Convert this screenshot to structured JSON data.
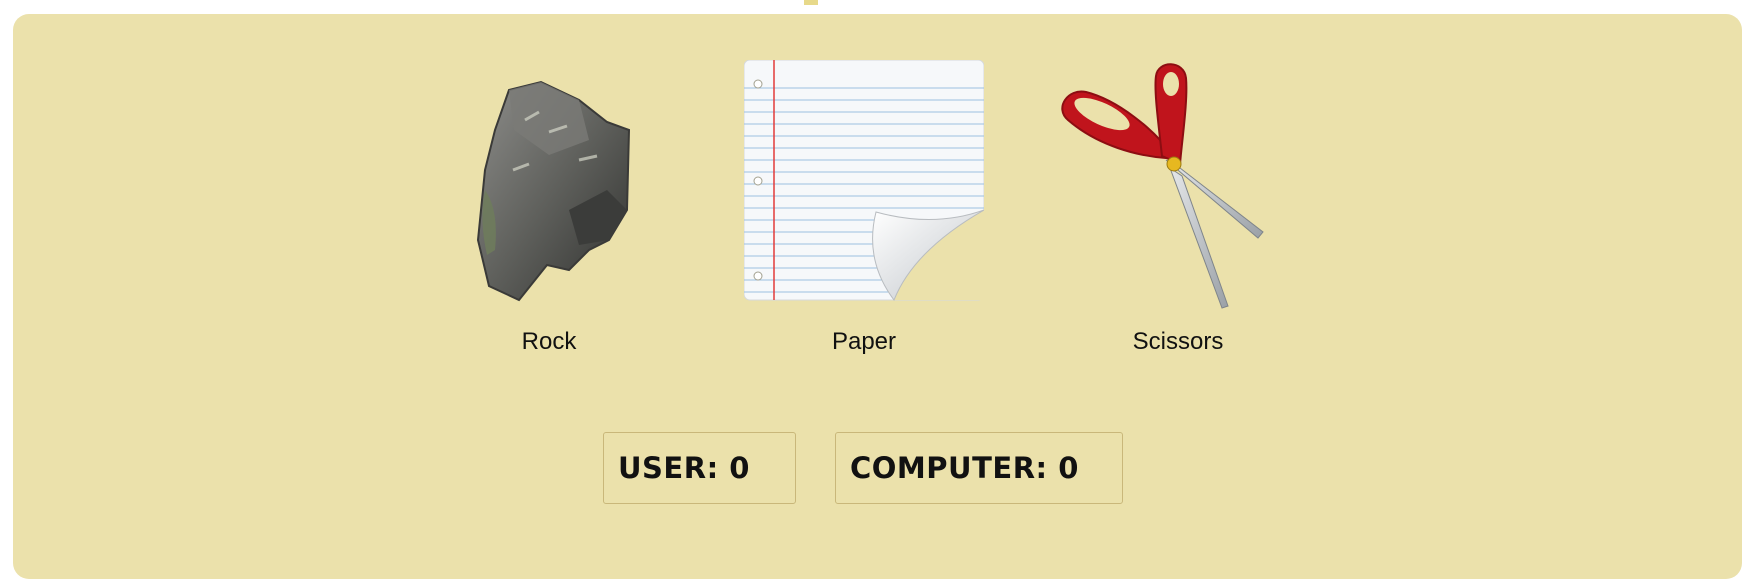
{
  "choices": [
    {
      "id": "rock",
      "label": "Rock",
      "icon": "rock-icon"
    },
    {
      "id": "paper",
      "label": "Paper",
      "icon": "paper-icon"
    },
    {
      "id": "scissors",
      "label": "Scissors",
      "icon": "scissors-icon"
    }
  ],
  "scores": {
    "user_label": "USER:",
    "user_value": "0",
    "computer_label": "COMPUTER:",
    "computer_value": "0"
  },
  "colors": {
    "panel_background": "#ebe1ab",
    "scissors_handle": "#c0141c",
    "paper_margin_line": "#e23b3b",
    "paper_rule_line": "#9cc0e0"
  }
}
